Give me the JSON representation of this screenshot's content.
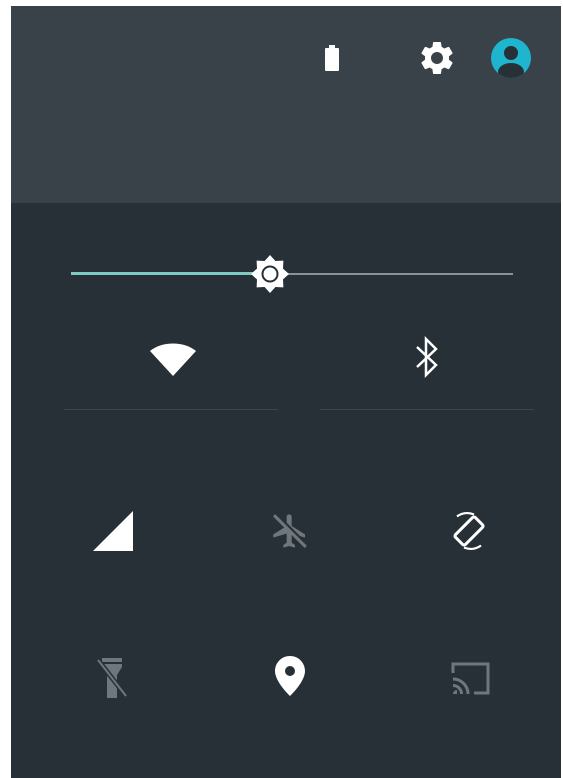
{
  "colors": {
    "panel_background": "#263036",
    "header_background": "#394248",
    "icon_active": "#ffffff",
    "icon_inactive": "#6f777c",
    "accent": "#7fcbc4",
    "avatar": "#1fb5cf"
  },
  "status_header": {
    "icons": [
      "battery-icon",
      "settings-gear-icon",
      "user-avatar-icon"
    ]
  },
  "brightness": {
    "level_percent": 45
  },
  "tiles": [
    {
      "icon": "wifi-icon",
      "state": "on"
    },
    {
      "icon": "bluetooth-icon",
      "state": "on"
    },
    {
      "icon": "cell-signal-icon",
      "state": "on"
    },
    {
      "icon": "airplane-mode-icon",
      "state": "off"
    },
    {
      "icon": "auto-rotate-icon",
      "state": "on"
    },
    {
      "icon": "flashlight-icon",
      "state": "off"
    },
    {
      "icon": "location-icon",
      "state": "on"
    },
    {
      "icon": "cast-icon",
      "state": "off"
    }
  ]
}
